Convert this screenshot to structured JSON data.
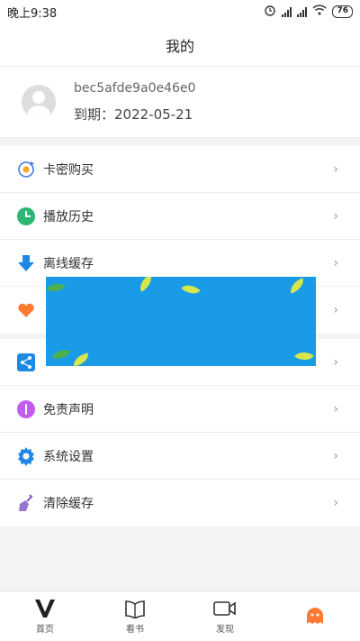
{
  "status_bar": {
    "time": "晚上9:38",
    "battery": "76"
  },
  "header": {
    "title": "我的"
  },
  "profile": {
    "user_id": "bec5afde9a0e46e0",
    "expiry": "到期：2022-05-21"
  },
  "menu_group_1": [
    {
      "label": "卡密购买",
      "icon": "card-icon"
    },
    {
      "label": "播放历史",
      "icon": "clock-icon"
    },
    {
      "label": "离线缓存",
      "icon": "download-icon"
    },
    {
      "label": "",
      "icon": "heart-icon"
    }
  ],
  "menu_group_2": [
    {
      "label": "",
      "icon": "share-icon"
    },
    {
      "label": "免责声明",
      "icon": "info-icon"
    },
    {
      "label": "系统设置",
      "icon": "gear-icon"
    },
    {
      "label": "清除缓存",
      "icon": "broom-icon"
    }
  ],
  "chevron": "›",
  "bottom_nav": [
    {
      "label": "首页",
      "icon": "v-logo-icon"
    },
    {
      "label": "看书",
      "icon": "book-icon"
    },
    {
      "label": "发现",
      "icon": "video-icon"
    },
    {
      "label": "",
      "icon": "mascot-icon"
    }
  ],
  "colors": {
    "accent_orange": "#ff7a33",
    "ad_blue": "#1a9be8"
  }
}
